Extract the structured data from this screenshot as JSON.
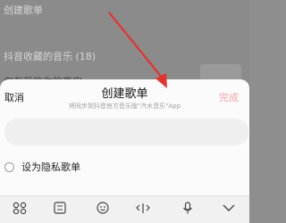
{
  "background": {
    "section_title": "创建歌单",
    "playlist_item": "抖音收藏的音乐 (18)",
    "partial_item": "仅有我的你的真实"
  },
  "sheet": {
    "cancel_label": "取消",
    "title": "创建歌单",
    "done_label": "完成",
    "subtitle": "将同步到抖音官方音乐版\"汽水音乐\"App",
    "name_input_value": "",
    "private_label": "设为隐私歌单"
  },
  "keyboard_toolbar": {
    "icons": [
      "grid-icon",
      "keyboard-icon",
      "emoji-icon",
      "cursor-move-icon",
      "microphone-icon",
      "chevron-down-icon"
    ]
  },
  "colors": {
    "accent_disabled": "#f3a3a8",
    "arrow": "#e3332f"
  }
}
